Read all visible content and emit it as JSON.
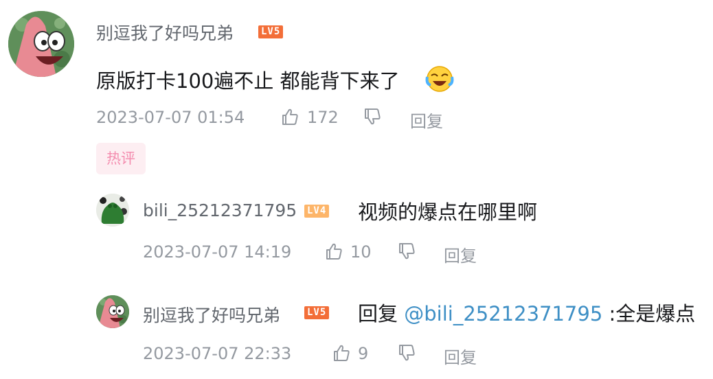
{
  "main_comment": {
    "username": "别逗我了好吗兄弟",
    "level": "LV5",
    "text": "原版打卡100遍不止 都能背下来了",
    "time": "2023-07-07 01:54",
    "likes": "172",
    "reply_label": "回复",
    "badge": "热评"
  },
  "replies": [
    {
      "username": "bili_25212371795",
      "level": "LV4",
      "text": "视频的爆点在哪里啊",
      "time": "2023-07-07 14:19",
      "likes": "10",
      "reply_label": "回复"
    },
    {
      "username": "别逗我了好吗兄弟",
      "level": "LV5",
      "text_prefix": "回复",
      "mention": "@bili_25212371795",
      "text_suffix": ":全是爆点",
      "time": "2023-07-07 22:33",
      "likes": "9",
      "reply_label": "回复"
    }
  ],
  "icons": {
    "like": "thumbs-up-icon",
    "dislike": "thumbs-down-icon",
    "emoji": "laughing-tears-emoji"
  },
  "colors": {
    "username": "#61666d",
    "text": "#18191c",
    "meta": "#9499a0",
    "mention": "#3e8fc5",
    "lv5": "#f36e38",
    "lv4": "#fdb569",
    "hot_bg": "#fdeef2",
    "hot_text": "#f48daf"
  }
}
